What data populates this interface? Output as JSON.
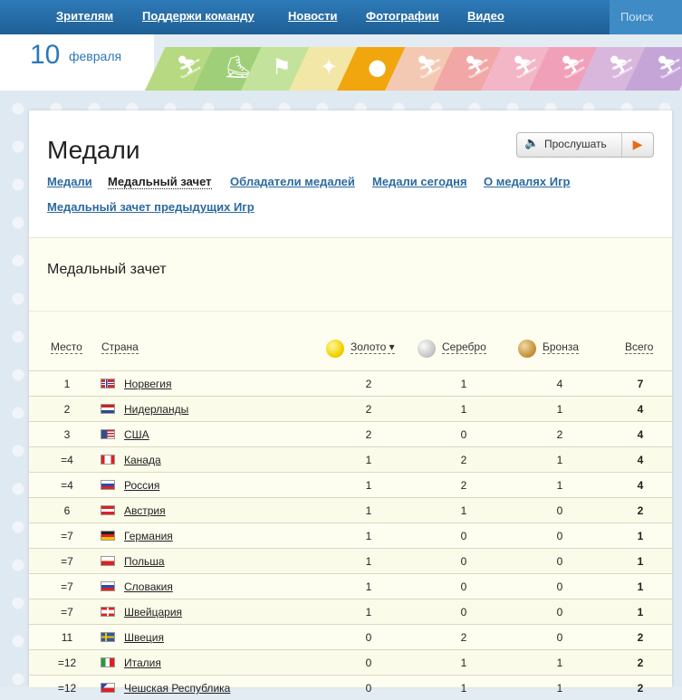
{
  "topnav": {
    "items": [
      "Зрителям",
      "Поддержи команду",
      "Новости",
      "Фотографии",
      "Видео"
    ],
    "search_label": "Поиск"
  },
  "date": {
    "day": "10",
    "month": "февраля"
  },
  "sports": [
    {
      "icon": "alpine-skiing-icon",
      "color": "#b7d982",
      "glyph": "⛷"
    },
    {
      "icon": "speed-skating-icon",
      "color": "#9fcf78",
      "glyph": "⛸"
    },
    {
      "icon": "biathlon-icon",
      "color": "#c3e39c",
      "glyph": "⚑"
    },
    {
      "icon": "figure-skating-icon",
      "color": "#f3e7a7",
      "glyph": "✦"
    },
    {
      "icon": "curling-icon",
      "color": "#f0a60c",
      "glyph": "●"
    },
    {
      "icon": "cross-country-icon",
      "color": "#f4c9b3",
      "glyph": "⛷"
    },
    {
      "icon": "ski-jumping-icon",
      "color": "#f1a7a5",
      "glyph": "⛷"
    },
    {
      "icon": "freestyle-icon",
      "color": "#f3b6c6",
      "glyph": "⛷"
    },
    {
      "icon": "snowboard-icon",
      "color": "#f1a0b9",
      "glyph": "⛷"
    },
    {
      "icon": "luge-icon",
      "color": "#d9b7dd",
      "glyph": "⛷"
    },
    {
      "icon": "bobsleigh-icon",
      "color": "#c5a5d8",
      "glyph": "⛷"
    }
  ],
  "page": {
    "title": "Медали",
    "listen_label": "Прослушать",
    "subnav": [
      "Медали",
      "Медальный зачет",
      "Обладатели медалей",
      "Медали сегодня",
      "О медалях Игр",
      "Медальный зачет предыдущих Игр"
    ],
    "section_title": "Медальный зачет"
  },
  "table": {
    "headers": {
      "place": "Место",
      "country": "Страна",
      "gold": "Золото ▾",
      "silver": "Серебро",
      "bronze": "Бронза",
      "total": "Всего"
    },
    "rows": [
      {
        "place": "1",
        "country": "Норвегия",
        "flag": "no",
        "gold": "2",
        "silver": "1",
        "bronze": "4",
        "total": "7"
      },
      {
        "place": "2",
        "country": "Нидерланды",
        "flag": "nl",
        "gold": "2",
        "silver": "1",
        "bronze": "1",
        "total": "4"
      },
      {
        "place": "3",
        "country": "США",
        "flag": "us",
        "gold": "2",
        "silver": "0",
        "bronze": "2",
        "total": "4"
      },
      {
        "place": "=4",
        "country": "Канада",
        "flag": "ca",
        "gold": "1",
        "silver": "2",
        "bronze": "1",
        "total": "4"
      },
      {
        "place": "=4",
        "country": "Россия",
        "flag": "ru",
        "gold": "1",
        "silver": "2",
        "bronze": "1",
        "total": "4"
      },
      {
        "place": "6",
        "country": "Австрия",
        "flag": "at",
        "gold": "1",
        "silver": "1",
        "bronze": "0",
        "total": "2"
      },
      {
        "place": "=7",
        "country": "Германия",
        "flag": "de",
        "gold": "1",
        "silver": "0",
        "bronze": "0",
        "total": "1"
      },
      {
        "place": "=7",
        "country": "Польша",
        "flag": "pl",
        "gold": "1",
        "silver": "0",
        "bronze": "0",
        "total": "1"
      },
      {
        "place": "=7",
        "country": "Словакия",
        "flag": "sk",
        "gold": "1",
        "silver": "0",
        "bronze": "0",
        "total": "1"
      },
      {
        "place": "=7",
        "country": "Швейцария",
        "flag": "ch",
        "gold": "1",
        "silver": "0",
        "bronze": "0",
        "total": "1"
      },
      {
        "place": "11",
        "country": "Швеция",
        "flag": "se",
        "gold": "0",
        "silver": "2",
        "bronze": "0",
        "total": "2"
      },
      {
        "place": "=12",
        "country": "Италия",
        "flag": "it",
        "gold": "0",
        "silver": "1",
        "bronze": "1",
        "total": "2"
      },
      {
        "place": "=12",
        "country": "Чешская Республика",
        "flag": "cz",
        "gold": "0",
        "silver": "1",
        "bronze": "1",
        "total": "2"
      }
    ]
  }
}
